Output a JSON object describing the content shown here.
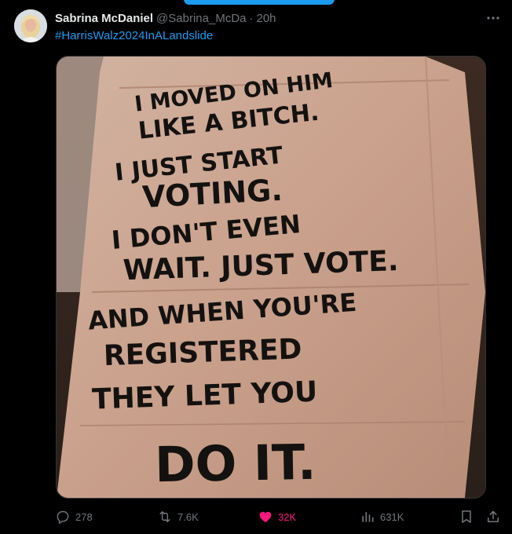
{
  "colors": {
    "background": "#000000",
    "primary_text": "#e7e9ea",
    "secondary_text": "#71767b",
    "link": "#1d9bf0",
    "like": "#f91880"
  },
  "author": {
    "display_name": "Sabrina McDaniel",
    "handle": "@Sabrina_McDa",
    "separator": "·",
    "time": "20h"
  },
  "tweet": {
    "hashtag": "#HarrisWalz2024InALandslide"
  },
  "media": {
    "sign_lines": [
      "I MOVED ON HIM",
      "LIKE A BITCH.",
      "I JUST START",
      "VOTING.",
      "I DON'T EVEN",
      "WAIT. JUST VOTE.",
      "AND WHEN YOU'RE",
      "REGISTERED",
      "THEY LET YOU",
      "DO IT."
    ]
  },
  "actions": {
    "reply_count": "278",
    "retweet_count": "7.6K",
    "like_count": "32K",
    "view_count": "631K",
    "like_active": true
  },
  "icons": {
    "more": "more-dots-icon",
    "reply": "reply-icon",
    "retweet": "retweet-icon",
    "like": "heart-icon",
    "views": "views-icon",
    "bookmark": "bookmark-icon",
    "share": "share-icon"
  }
}
